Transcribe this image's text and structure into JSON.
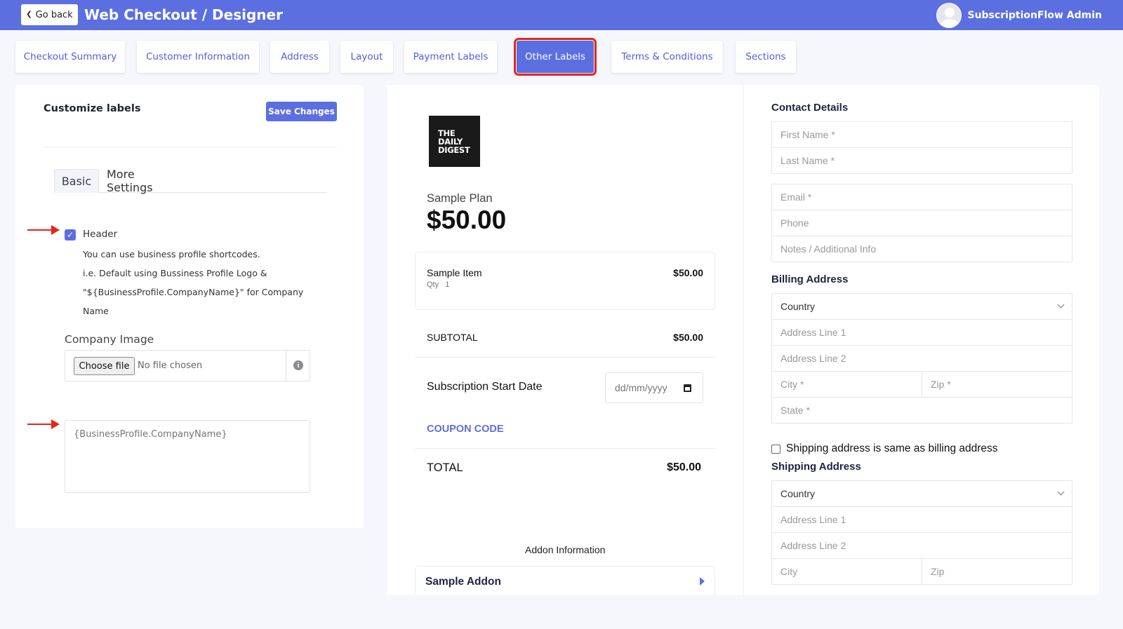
{
  "topbar": {
    "back_label": "Go back",
    "title": "Web Checkout / Designer",
    "user_name": "SubscriptionFlow Admin"
  },
  "tabs": [
    {
      "label": "Checkout Summary",
      "active": false
    },
    {
      "label": "Customer Information",
      "active": false
    },
    {
      "label": "Address",
      "active": false
    },
    {
      "label": "Layout",
      "active": false
    },
    {
      "label": "Payment Labels",
      "active": false
    },
    {
      "label": "Other Labels",
      "active": true
    },
    {
      "label": "Terms & Conditions",
      "active": false
    },
    {
      "label": "Sections",
      "active": false
    }
  ],
  "customize": {
    "title": "Customize labels",
    "save_label": "Save Changes",
    "subtabs": [
      "Basic",
      "More Settings"
    ],
    "header_checkbox": {
      "label": "Header",
      "checked": true
    },
    "help_lines": [
      "You can use business profile shortcodes.",
      "i.e. Default using Bussiness Profile Logo &",
      "\"${BusinessProfile.CompanyName}\" for Company",
      "Name"
    ],
    "company_image_label": "Company Image",
    "file_button": "Choose file",
    "file_status": "No file chosen",
    "company_name_placeholder": "{BusinessProfile.CompanyName}"
  },
  "preview": {
    "logo_lines": [
      "THE",
      "DAILY",
      "DIGEST"
    ],
    "plan_name": "Sample Plan",
    "plan_price": "$50.00",
    "item": {
      "name": "Sample Item",
      "qty_label": "Qty",
      "qty": "1",
      "price": "$50.00"
    },
    "subtotal_label": "SUBTOTAL",
    "subtotal_value": "$50.00",
    "start_date_label": "Subscription Start Date",
    "date_placeholder": "dd/mm/yyyy",
    "coupon_label": "COUPON CODE",
    "total_label": "TOTAL",
    "total_value": "$50.00",
    "addon_info_label": "Addon Information",
    "addon_name": "Sample Addon"
  },
  "form": {
    "contact_title": "Contact Details",
    "first_name": "First Name *",
    "last_name": "Last Name *",
    "email": "Email *",
    "phone": "Phone",
    "notes": "Notes / Additional Info",
    "billing_title": "Billing Address",
    "billing": {
      "country": "Country",
      "address1": "Address Line 1",
      "address2": "Address Line 2",
      "city": "City *",
      "zip": "Zip *",
      "state": "State *"
    },
    "same_address_label": "Shipping address is same as billing address",
    "shipping_title": "Shipping Address",
    "shipping": {
      "country": "Country",
      "address1": "Address Line 1",
      "address2": "Address Line 2",
      "city": "City",
      "zip": "Zip"
    }
  },
  "colors": {
    "accent": "#5b6fe0",
    "highlight_red": "#e8241c"
  }
}
